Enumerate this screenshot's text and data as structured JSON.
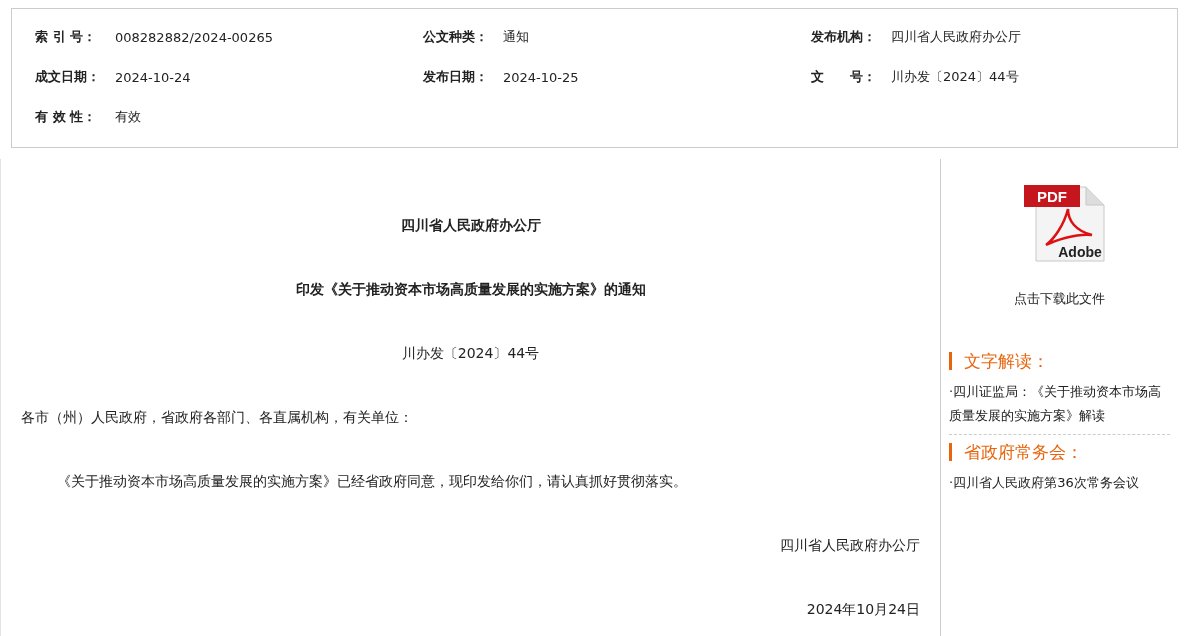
{
  "meta": [
    {
      "label": "索 引 号：",
      "value": "008282882/2024-00265"
    },
    {
      "label": "公文种类：",
      "value": "通知"
    },
    {
      "label": "发布机构：",
      "value": "四川省人民政府办公厅"
    },
    {
      "label": "成文日期：",
      "value": "2024-10-24"
    },
    {
      "label": "发布日期：",
      "value": "2024-10-25"
    },
    {
      "label": "文　　号：",
      "value": "川办发〔2024〕44号"
    },
    {
      "label": "有 效 性：",
      "value": "有效"
    }
  ],
  "document": {
    "issuer": "四川省人民政府办公厅",
    "title": "印发《关于推动资本市场高质量发展的实施方案》的通知",
    "number": "川办发〔2024〕44号",
    "salutation": "各市（州）人民政府，省政府各部门、各直属机构，有关单位：",
    "body": "《关于推动资本市场高质量发展的实施方案》已经省政府同意，现印发给你们，请认真抓好贯彻落实。",
    "signature": "四川省人民政府办公厅",
    "date": "2024年10月24日"
  },
  "sidebar": {
    "pdf_icon": {
      "banner": "PDF",
      "brand": "Adobe"
    },
    "download": "点击下载此文件",
    "sections": [
      {
        "heading": "文字解读：",
        "links": [
          "·四川证监局：《关于推动资本市场高质量发展的实施方案》解读"
        ]
      },
      {
        "heading": "省政府常务会：",
        "links": [
          "·四川省人民政府第36次常务会议"
        ]
      }
    ]
  }
}
